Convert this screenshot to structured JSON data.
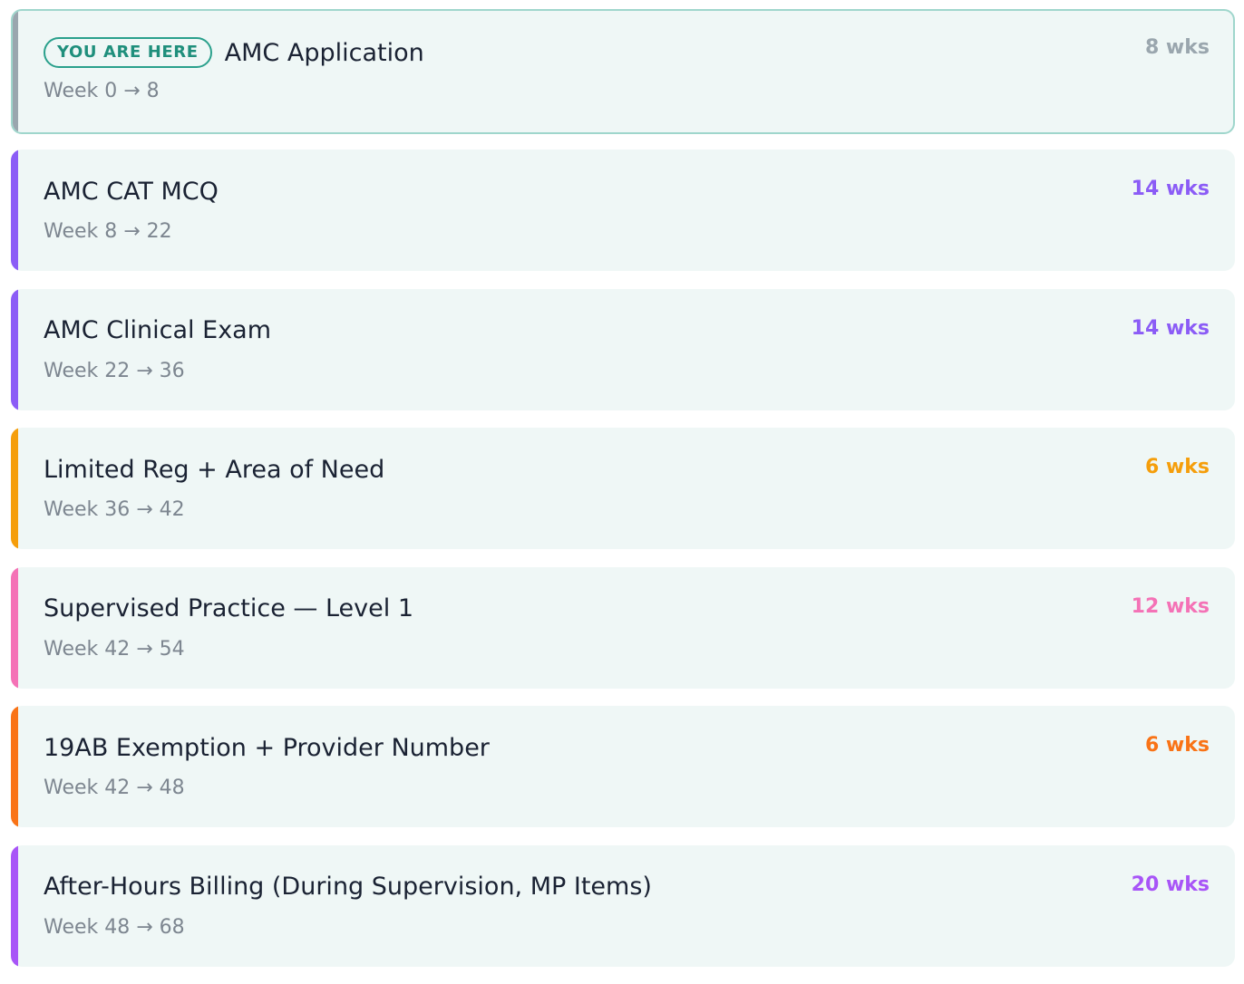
{
  "badge": {
    "label": "YOU ARE HERE"
  },
  "phases": [
    {
      "title": "AMC Application",
      "range": "Week 0 → 8",
      "duration": "8 wks",
      "color": "#9aa6ae",
      "current": true
    },
    {
      "title": "AMC CAT MCQ",
      "range": "Week 8 → 22",
      "duration": "14 wks",
      "color": "#8b5cf6",
      "current": false
    },
    {
      "title": "AMC Clinical Exam",
      "range": "Week 22 → 36",
      "duration": "14 wks",
      "color": "#8b5cf6",
      "current": false
    },
    {
      "title": "Limited Reg + Area of Need",
      "range": "Week 36 → 42",
      "duration": "6 wks",
      "color": "#f59e0b",
      "current": false
    },
    {
      "title": "Supervised Practice — Level 1",
      "range": "Week 42 → 54",
      "duration": "12 wks",
      "color": "#f472b6",
      "current": false
    },
    {
      "title": "19AB Exemption + Provider Number",
      "range": "Week 42 → 48",
      "duration": "6 wks",
      "color": "#f97316",
      "current": false
    },
    {
      "title": "After-Hours Billing (During Supervision, MP Items)",
      "range": "Week 48 → 68",
      "duration": "20 wks",
      "color": "#a855f7",
      "current": false
    }
  ]
}
